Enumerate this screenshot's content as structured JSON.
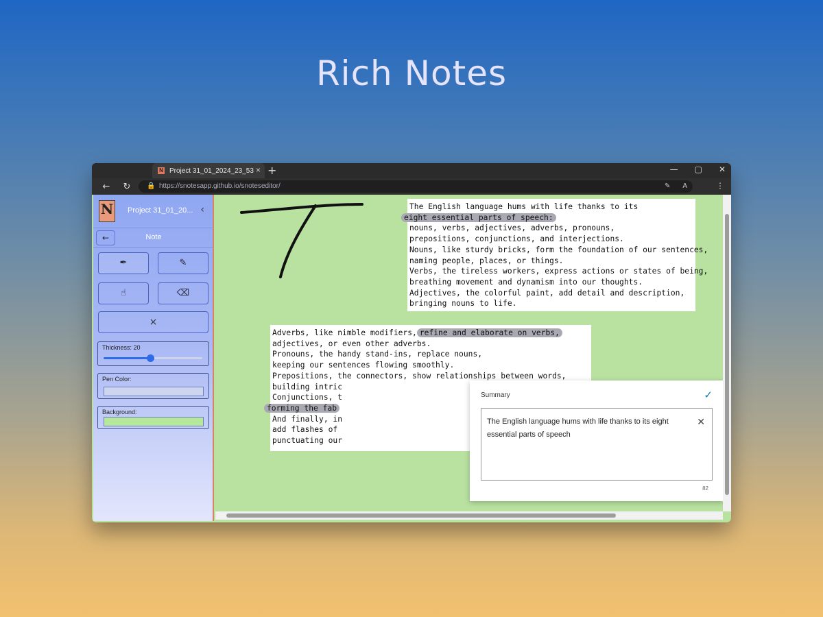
{
  "hero": {
    "title": "Rich Notes"
  },
  "browser": {
    "tab_title": "Project 31_01_2024_23_53",
    "favicon_letter": "N",
    "url": "https://snotesapp.github.io/snoteseditor/"
  },
  "sidebar": {
    "logo_letter": "N",
    "project_name": "Project 31_01_20...",
    "note_label": "Note",
    "tools": [
      {
        "name": "pen-icon",
        "glyph": "✒"
      },
      {
        "name": "pencil-icon",
        "glyph": "✎"
      },
      {
        "name": "hand-icon",
        "glyph": "☝"
      },
      {
        "name": "eraser-icon",
        "glyph": "⌫"
      }
    ],
    "clear_glyph": "×",
    "thickness_label": "Thickness: 20",
    "thickness_value": 20,
    "thickness_fraction": 0.47,
    "pen_color_label": "Pen Color:",
    "pen_color": "#cdd5ef",
    "background_label": "Background:",
    "background_color": "#b6e89c"
  },
  "canvas": {
    "background_color": "#b9e2a0",
    "textbox1": {
      "line1": "The English language hums with life thanks to its",
      "highlight": "eight essential parts of speech:",
      "rest": "nouns, verbs, adjectives, adverbs, pronouns,\nprepositions, conjunctions, and interjections.\nNouns, like sturdy bricks, form the foundation of our sentences,\nnaming people, places, or things.\nVerbs, the tireless workers, express actions or states of being,\nbreathing movement and dynamism into our thoughts.\nAdjectives, the colorful paint, add detail and description,\nbringing nouns to life."
    },
    "textbox2": {
      "line1_a": "Adverbs, like nimble modifiers,",
      "line1_highlight": "refine and elaborate on verbs,",
      "lines_mid": "adjectives, or even other adverbs.\nPronouns, the handy stand-ins, replace nouns,\nkeeping our sentences flowing smoothly.\nPrepositions, the connectors, show relationships between words,\nbuilding intric\nConjunctions, t",
      "line_highlight": "forming the fab",
      "lines_end": "And finally, in\nadd flashes of \npunctuating our"
    },
    "summary": {
      "title": "Summary",
      "text": "The English language hums with life thanks to its eight essential parts of speech",
      "count": "82"
    }
  }
}
